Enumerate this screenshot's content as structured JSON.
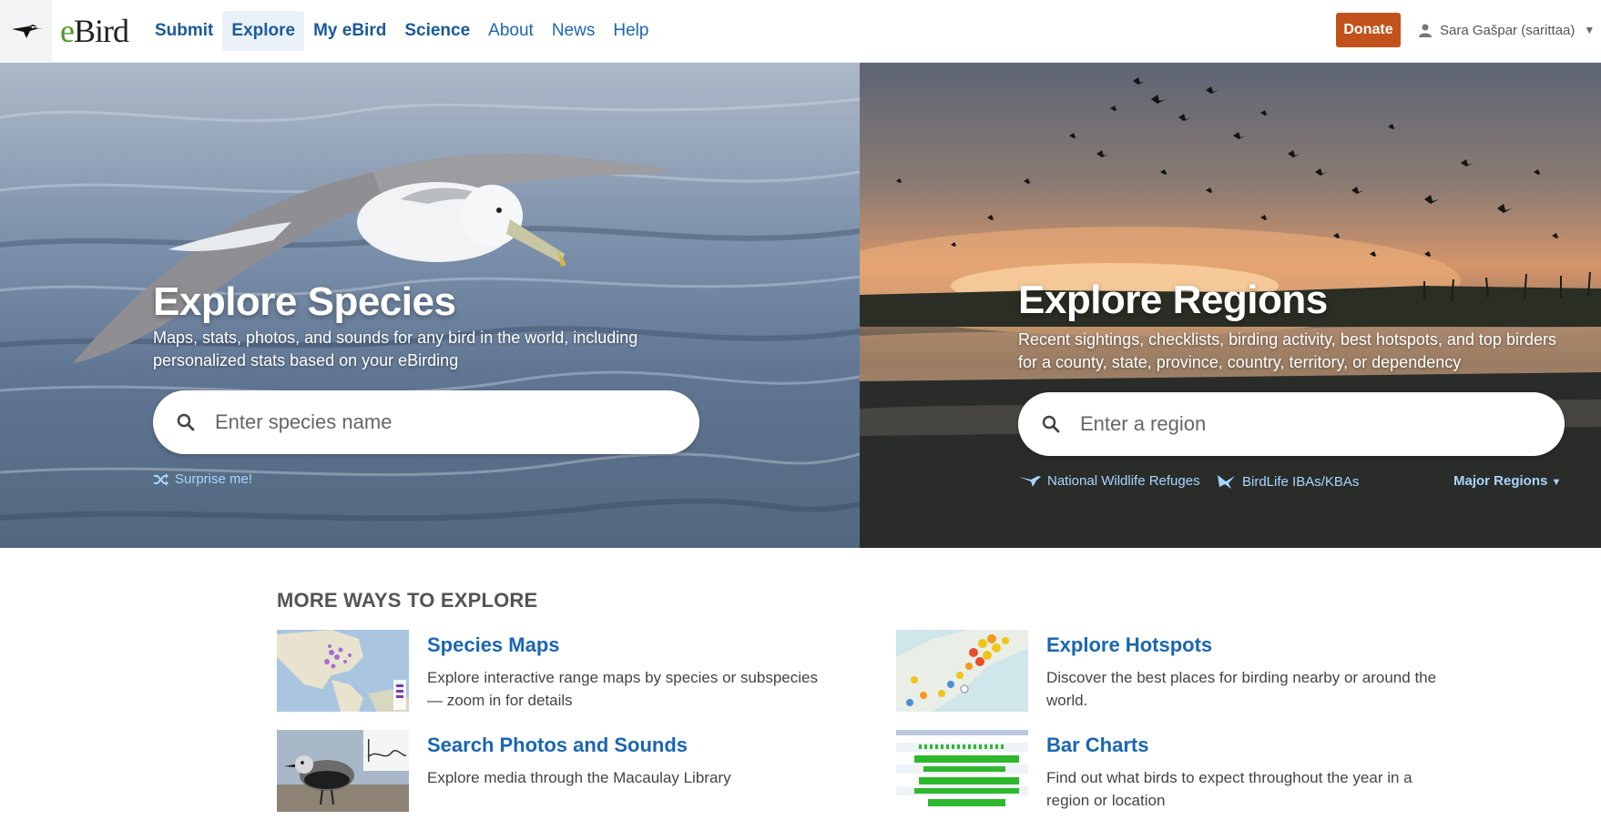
{
  "brand": {
    "name": "eBird"
  },
  "nav": {
    "items": [
      {
        "label": "Submit"
      },
      {
        "label": "Explore"
      },
      {
        "label": "My eBird"
      },
      {
        "label": "Science"
      },
      {
        "label": "About"
      },
      {
        "label": "News"
      },
      {
        "label": "Help"
      }
    ],
    "active": "Explore"
  },
  "donate_label": "Donate",
  "user": {
    "name": "Sara Gašpar (sarittaa)"
  },
  "species": {
    "title": "Explore Species",
    "subtitle_line1": "Maps, stats, photos, and sounds for any bird in the world, including",
    "subtitle_line2": "personalized stats based on your eBirding",
    "search_placeholder": "Enter species name",
    "surprise_label": "Surprise me!"
  },
  "regions": {
    "title": "Explore Regions",
    "subtitle_line1": "Recent sightings, checklists, birding activity, best hotspots, and top birders",
    "subtitle_line2": "for a county, state, province, country, territory, or dependency",
    "search_placeholder": "Enter a region",
    "nwr_label": "National Wildlife Refuges",
    "iba_label": "BirdLife IBAs/KBAs",
    "major_label": "Major Regions"
  },
  "more": {
    "heading": "MORE WAYS TO EXPLORE",
    "cards": [
      {
        "title": "Species Maps",
        "desc": "Explore interactive range maps by species or subspecies — zoom in for details"
      },
      {
        "title": "Explore Hotspots",
        "desc": "Discover the best places for birding nearby or around the world."
      },
      {
        "title": "Search Photos and Sounds",
        "desc": "Explore media through the Macaulay Library"
      },
      {
        "title": "Bar Charts",
        "desc": "Find out what birds to expect throughout the year in a region or location"
      }
    ]
  },
  "colors": {
    "link": "#1a66b3",
    "donate": "#c2521b",
    "hero_link": "#a9d5ff",
    "brand_green": "#4f9a2a"
  }
}
